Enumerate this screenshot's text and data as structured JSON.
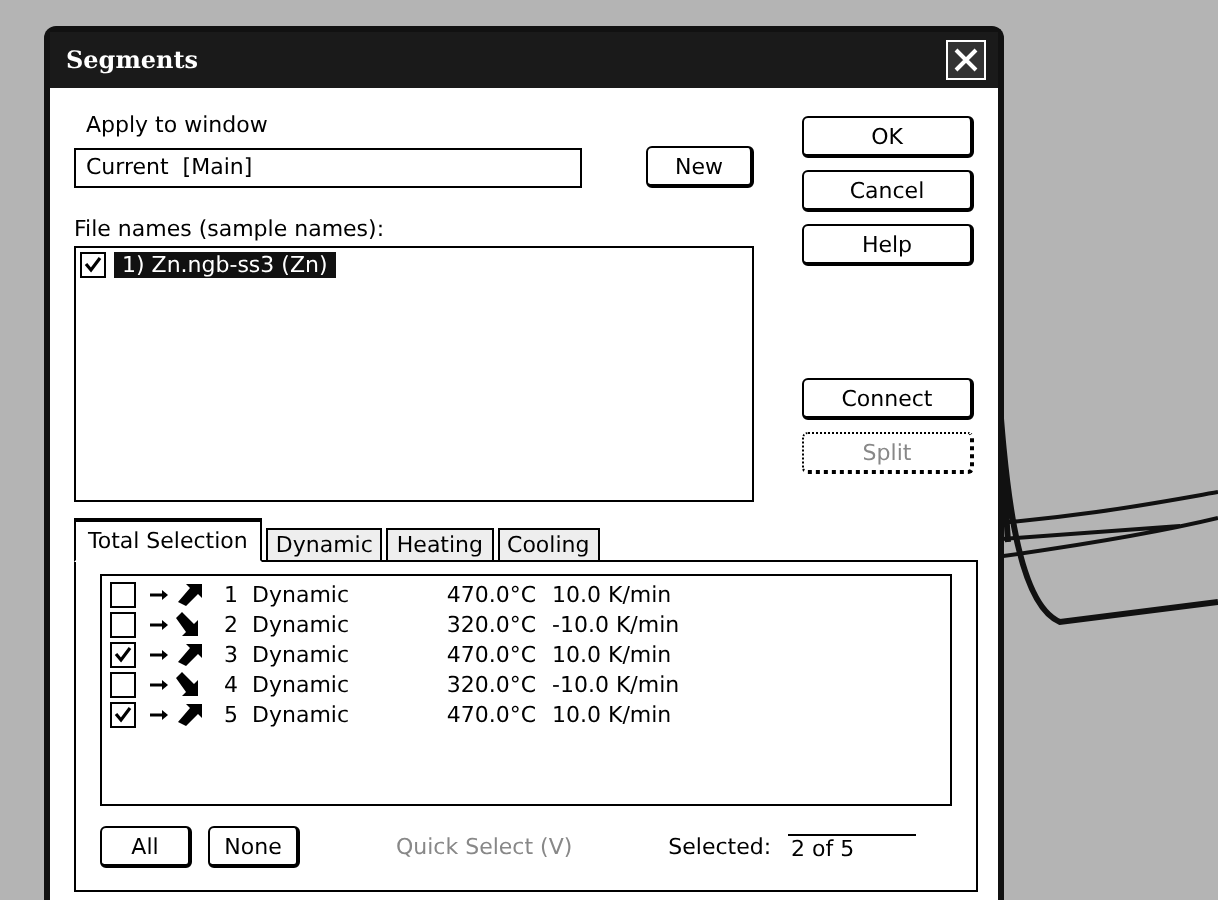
{
  "window": {
    "title": "Segments"
  },
  "apply": {
    "label": "Apply to window",
    "value": "Current  [Main]",
    "new_button": "New"
  },
  "buttons": [
    {
      "label": "OK",
      "disabled": false
    },
    {
      "label": "Cancel",
      "disabled": false
    },
    {
      "label": "Help",
      "disabled": false
    }
  ],
  "files": {
    "label": "File names (sample names):",
    "items": [
      {
        "label": "1) Zn.ngb-ss3 (Zn)",
        "checked": true,
        "selected": true
      }
    ]
  },
  "file_buttons": [
    {
      "label": "Connect",
      "disabled": false
    },
    {
      "label": "Split",
      "disabled": true
    }
  ],
  "tabs": [
    {
      "label": "Total Selection",
      "selected": true
    },
    {
      "label": "Dynamic",
      "selected": false
    },
    {
      "label": "Heating",
      "selected": false
    },
    {
      "label": "Cooling",
      "selected": false
    }
  ],
  "segments": [
    {
      "checked": false,
      "kind": "heating",
      "number": "1",
      "type": "Dynamic",
      "temperature": "470.0°C",
      "rate": "10.0 K/min"
    },
    {
      "checked": false,
      "kind": "cooling",
      "number": "2",
      "type": "Dynamic",
      "temperature": "320.0°C",
      "rate": "-10.0 K/min"
    },
    {
      "checked": true,
      "kind": "heating",
      "number": "3",
      "type": "Dynamic",
      "temperature": "470.0°C",
      "rate": "10.0 K/min"
    },
    {
      "checked": false,
      "kind": "cooling",
      "number": "4",
      "type": "Dynamic",
      "temperature": "320.0°C",
      "rate": "-10.0 K/min"
    },
    {
      "checked": true,
      "kind": "heating",
      "number": "5",
      "type": "Dynamic",
      "temperature": "470.0°C",
      "rate": "10.0 K/min"
    }
  ],
  "footer": {
    "all_button": "All",
    "none_button": "None",
    "quick_select": {
      "label": "Quick Select (V)",
      "disabled": true
    },
    "selected_label": "Selected:",
    "selected_value": "2 of 5"
  }
}
